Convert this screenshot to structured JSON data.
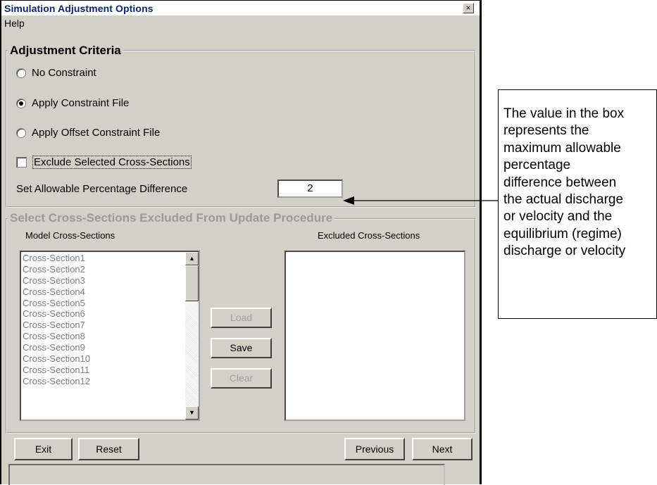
{
  "window": {
    "title": "Simulation Adjustment Options",
    "close_glyph": "×"
  },
  "menu": {
    "help": "Help"
  },
  "adjustment_criteria": {
    "legend": "Adjustment Criteria",
    "options": [
      {
        "label": "No Constraint",
        "selected": false
      },
      {
        "label": "Apply Constraint File",
        "selected": true
      },
      {
        "label": "Apply Offset Constraint File",
        "selected": false
      }
    ],
    "exclude_checkbox_label": "Exclude Selected Cross-Sections",
    "exclude_checked": false,
    "percentage_label": "Set Allowable Percentage Difference",
    "percentage_value": "2"
  },
  "cross_sections": {
    "legend": "Select Cross-Sections Excluded From Update Procedure",
    "model_header": "Model Cross-Sections",
    "excluded_header": "Excluded Cross-Sections",
    "model_items": [
      "Cross-Section1",
      "Cross-Section2",
      "Cross-Section3",
      "Cross-Section4",
      "Cross-Section5",
      "Cross-Section6",
      "Cross-Section7",
      "Cross-Section8",
      "Cross-Section9",
      "Cross-Section10",
      "Cross-Section11",
      "Cross-Section12"
    ],
    "excluded_items": [],
    "buttons": {
      "load": "Load",
      "save": "Save",
      "clear": "Clear"
    }
  },
  "bottom_buttons": {
    "exit": "Exit",
    "reset": "Reset",
    "previous": "Previous",
    "next": "Next"
  },
  "callout": {
    "text": "The value in the box\nrepresents the\nmaximum allowable\npercentage\ndifference between\nthe actual discharge\nor velocity and the\nequilibrium (regime)\ndischarge or velocity"
  }
}
